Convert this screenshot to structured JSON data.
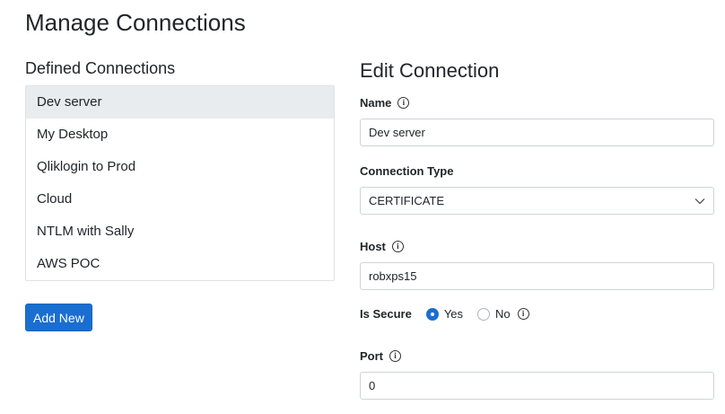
{
  "page": {
    "title": "Manage Connections"
  },
  "connections": {
    "title": "Defined Connections",
    "items": [
      {
        "label": "Dev server"
      },
      {
        "label": "My Desktop"
      },
      {
        "label": "Qliklogin to Prod"
      },
      {
        "label": "Cloud"
      },
      {
        "label": "NTLM with Sally"
      },
      {
        "label": "AWS POC"
      }
    ],
    "selected": "Dev server",
    "add_button": "Add New"
  },
  "edit": {
    "title": "Edit Connection",
    "name": {
      "label": "Name",
      "value": "Dev server"
    },
    "connection_type": {
      "label": "Connection Type",
      "value": "CERTIFICATE"
    },
    "host": {
      "label": "Host",
      "value": "robxps15"
    },
    "is_secure": {
      "label": "Is Secure",
      "yes": "Yes",
      "no": "No",
      "selected": "Yes"
    },
    "port": {
      "label": "Port",
      "value": "0"
    }
  },
  "colors": {
    "accent": "#1a6ed0",
    "active_row": "#e9ecef",
    "border": "#ced4da"
  },
  "icons": {
    "info": "info-circle-icon",
    "select": "chevron-down-icon"
  }
}
